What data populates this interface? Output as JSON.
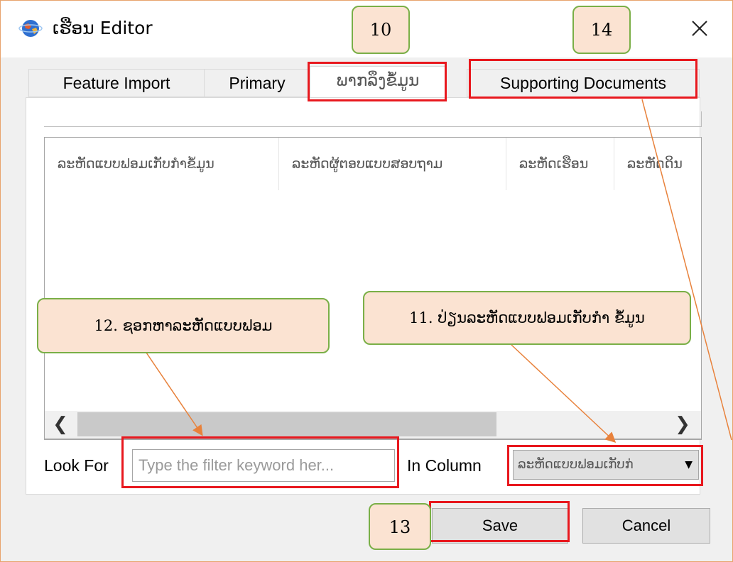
{
  "window": {
    "title": "ເຮືອນ Editor",
    "close_symbol": "✕"
  },
  "tabs": [
    {
      "label": "Feature Import",
      "active": false
    },
    {
      "label": "Primary",
      "active": false
    },
    {
      "label": "ພາກລຶງຂໍ້ມູນ",
      "active": true
    },
    {
      "label": "Supporting Documents",
      "active": false
    }
  ],
  "grid": {
    "columns": [
      "ລະຫັດແບບຟອມເກັບກຳຂໍ້ມູນ",
      "ລະຫັດຜູ້ຕອບແບບສອບຖາມ",
      "ລະຫັດເຮືອນ",
      "ລະຫັດດິນ"
    ],
    "scroll_left": "❮",
    "scroll_right": "❯"
  },
  "filter": {
    "look_for_label": "Look For",
    "placeholder": "Type the filter keyword her...",
    "in_column_label": "In Column",
    "selected_column": "ລະຫັດແບບຟອມເກັບກ່"
  },
  "buttons": {
    "save": "Save",
    "cancel": "Cancel"
  },
  "annotations": {
    "tab_callout": "10",
    "support_callout": "14",
    "save_callout": "13",
    "select_callout": "11. ປ່ຽນລະຫັດແບບຟອມເກັບກຳ ຂໍ້ມູນ",
    "search_callout": "12. ຊອກຫາລະຫັດແບບຟອມ"
  },
  "colors": {
    "highlight_box": "#e8181e",
    "callout_fill": "#fbe3d2",
    "callout_border": "#7aaf47",
    "arrow": "#e8823c"
  },
  "icons": {
    "app": "globe-icon",
    "close": "close-icon",
    "dropdown": "chevron-down-icon"
  }
}
